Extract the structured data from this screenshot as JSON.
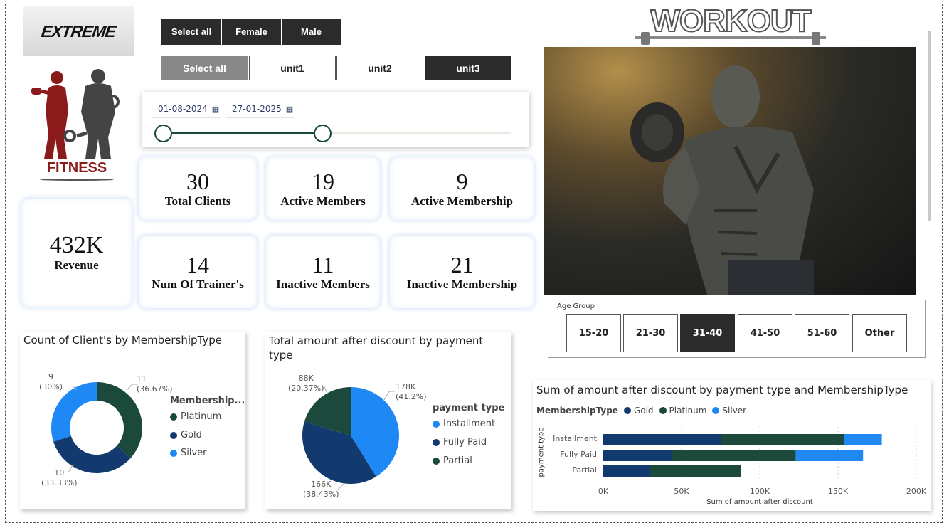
{
  "logo": {
    "brand_top": "EXTREME",
    "brand_bottom": "FITNESS"
  },
  "gender_slicer": {
    "options": [
      "Select all",
      "Female",
      "Male"
    ]
  },
  "unit_slicer": {
    "options": [
      "Select all",
      "unit1",
      "unit2",
      "unit3"
    ]
  },
  "date_slicer": {
    "start": "01-08-2024",
    "end": "27-01-2025"
  },
  "cards": {
    "revenue": {
      "value": "432K",
      "label": "Revenue"
    },
    "total_clients": {
      "value": "30",
      "label": "Total Clients"
    },
    "active_members": {
      "value": "19",
      "label": "Active Members"
    },
    "active_membership": {
      "value": "9",
      "label": "Active Membership"
    },
    "num_trainers": {
      "value": "14",
      "label": "Num Of Trainer's"
    },
    "inactive_members": {
      "value": "11",
      "label": "Inactive Members"
    },
    "inactive_membership": {
      "value": "21",
      "label": "Inactive Membership"
    }
  },
  "workout_title": "WORKOUT",
  "age_group": {
    "title": "Age Group",
    "options": [
      "15-20",
      "21-30",
      "31-40",
      "41-50",
      "51-60",
      "Other"
    ],
    "selected": "31-40"
  },
  "colors": {
    "platinum": "#1b4a3c",
    "gold": "#123a6e",
    "silver": "#1e88f5",
    "dark_button": "#2b2b2b"
  },
  "chart_data": [
    {
      "type": "pie",
      "variant": "donut",
      "title": "Count of Client's by MembershipType",
      "legend_title": "Membership...",
      "categories": [
        "Platinum",
        "Gold",
        "Silver"
      ],
      "values": [
        11,
        10,
        9
      ],
      "labels": [
        {
          "value": "11",
          "pct": "(36.67%)"
        },
        {
          "value": "10",
          "pct": "(33.33%)"
        },
        {
          "value": "9",
          "pct": "(30%)"
        }
      ]
    },
    {
      "type": "pie",
      "title": "Total amount after discount by payment type",
      "legend_title": "payment type",
      "categories": [
        "Installment",
        "Fully Paid",
        "Partial"
      ],
      "values": [
        178,
        166,
        88
      ],
      "labels": [
        {
          "value": "178K",
          "pct": "(41.2%)"
        },
        {
          "value": "166K",
          "pct": "(38.43%)"
        },
        {
          "value": "88K",
          "pct": "(20.37%)"
        }
      ]
    },
    {
      "type": "bar",
      "orientation": "horizontal",
      "stacked": true,
      "title": "Sum of amount after discount by payment type and MembershipType",
      "legend_title": "MembershipType",
      "categories": [
        "Installment",
        "Fully Paid",
        "Partial"
      ],
      "series": [
        {
          "name": "Gold",
          "values": [
            75,
            44,
            30
          ]
        },
        {
          "name": "Platinum",
          "values": [
            79,
            79,
            58
          ]
        },
        {
          "name": "Silver",
          "values": [
            24,
            43,
            0
          ]
        }
      ],
      "ticks": [
        "0K",
        "50K",
        "100K",
        "150K",
        "200K"
      ],
      "xlabel": "Sum of amount after discount",
      "ylabel": "payment type",
      "xlim": [
        0,
        200
      ]
    }
  ]
}
